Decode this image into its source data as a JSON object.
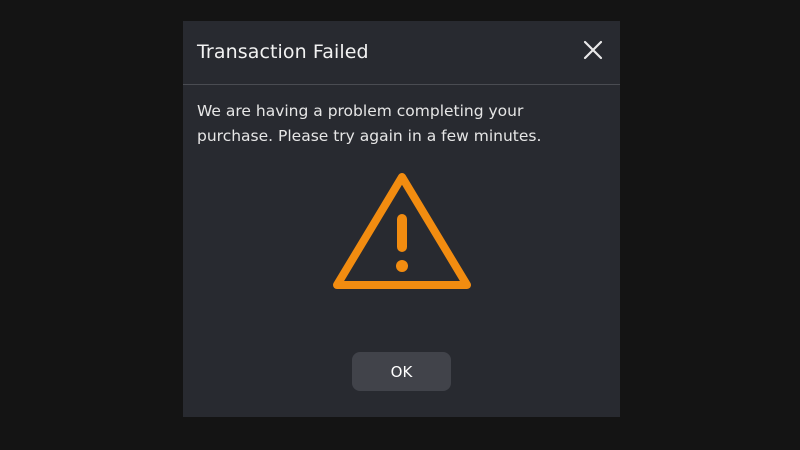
{
  "dialog": {
    "title": "Transaction Failed",
    "message": "We are having a problem completing your purchase. Please try again in a few minutes.",
    "close_icon": "close-icon",
    "warning_icon": "warning-triangle-icon",
    "ok_label": "OK"
  },
  "colors": {
    "background": "#141414",
    "dialog_background": "#282a30",
    "divider": "#4a4c52",
    "warning": "#f28c10",
    "button_background": "#41434a",
    "text": "#f2f2f2"
  }
}
